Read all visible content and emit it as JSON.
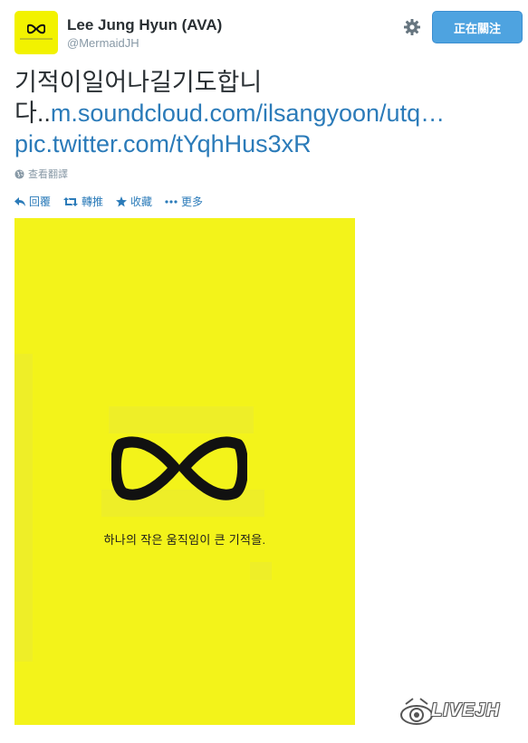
{
  "user": {
    "name": "Lee Jung Hyun (AVA)",
    "handle": "@MermaidJH"
  },
  "follow_button": {
    "label": "正在關注"
  },
  "tweet": {
    "text_line1": "기적이일어나길기도합니",
    "text_line2_prefix": "다..",
    "link_soundcloud": "m.soundcloud.com/ilsangyoon/utq…",
    "link_pic": "pic.twitter.com/tYqhHus3xR"
  },
  "translate": {
    "label": "查看翻譯"
  },
  "actions": {
    "reply": "回覆",
    "retweet": "轉推",
    "favorite": "收藏",
    "more": "更多"
  },
  "media": {
    "slogan": "하나의 작은 움직임이 큰 기적을."
  },
  "watermark": {
    "text": "LIVEJH"
  },
  "colors": {
    "link": "#2b7bb9",
    "follow_button_bg": "#4ea3e0",
    "poster_yellow": "#f3f31a"
  },
  "icons": [
    "gear-icon",
    "globe-icon",
    "reply-icon",
    "retweet-icon",
    "star-icon",
    "more-icon",
    "yellow-ribbon-icon",
    "eye-logo-icon"
  ]
}
